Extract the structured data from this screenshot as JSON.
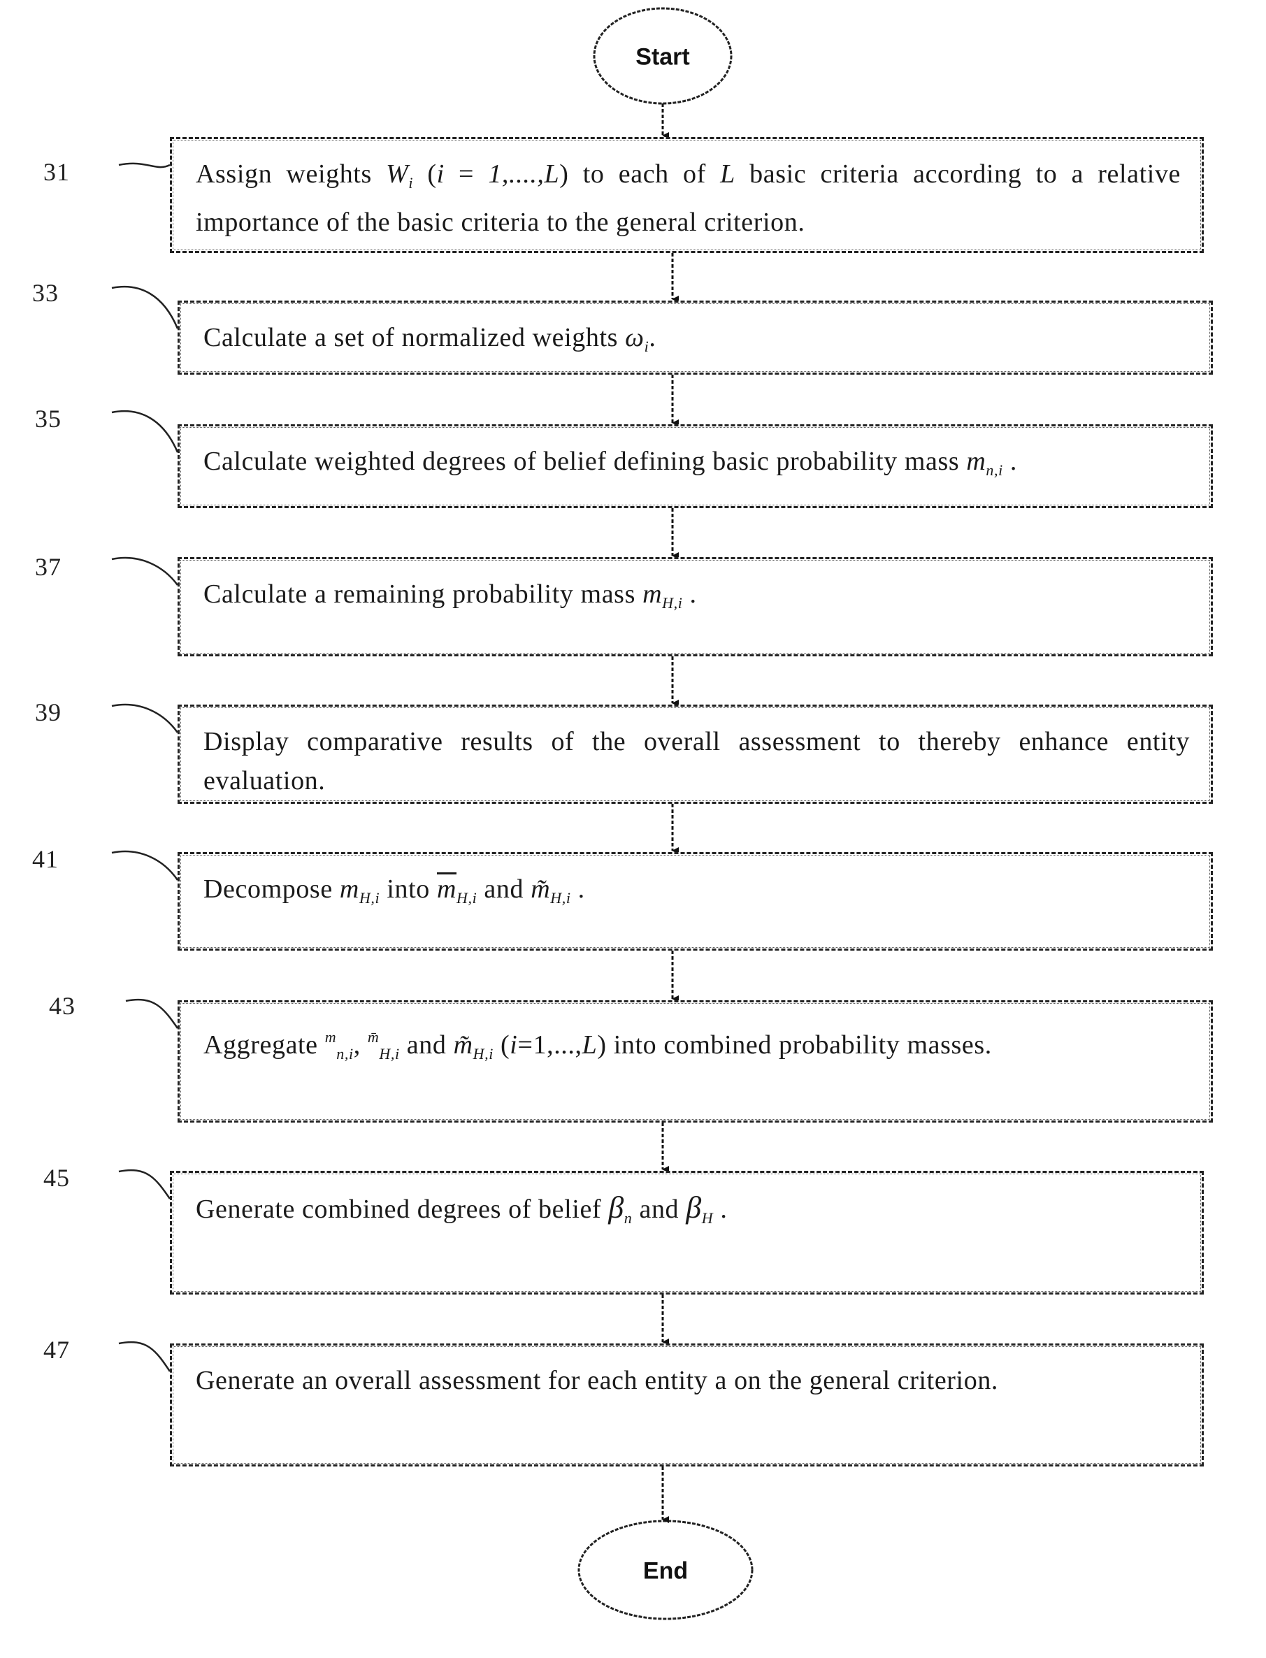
{
  "flowchart": {
    "start": {
      "label": "Start"
    },
    "end": {
      "label": "End"
    },
    "steps": [
      {
        "number": "31",
        "parts": [
          {
            "t": "Assign weights "
          },
          {
            "t": "W",
            "math": true
          },
          {
            "t": "i",
            "sub": true
          },
          {
            "t": " ("
          },
          {
            "t": "i",
            "math": true
          },
          {
            "t": " = "
          },
          {
            "t": "1,....,L",
            "math": true
          },
          {
            "t": ") to each of "
          },
          {
            "t": "L",
            "math": true
          },
          {
            "t": " basic criteria according to a relative importance of the basic criteria to the general criterion."
          }
        ],
        "text": "Assign weights W_i (i = 1,....,L) to each of L basic criteria according to a relative importance of the basic criteria to the general criterion."
      },
      {
        "number": "33",
        "parts": [
          {
            "t": "Calculate a set of normalized weights "
          },
          {
            "t": "ω",
            "math": true
          },
          {
            "t": "i",
            "sub": true
          },
          {
            "t": "."
          }
        ],
        "text": "Calculate a set of normalized weights ω_i."
      },
      {
        "number": "35",
        "parts": [
          {
            "t": "Calculate weighted degrees of belief defining basic probability mass "
          },
          {
            "t": "m",
            "math": true
          },
          {
            "t": "n,i",
            "sub": true
          },
          {
            "t": " ."
          }
        ],
        "text": "Calculate weighted degrees of belief defining basic probability mass m_n,i ."
      },
      {
        "number": "37",
        "parts": [
          {
            "t": "Calculate a remaining probability mass "
          },
          {
            "t": "m",
            "math": true
          },
          {
            "t": "H,i",
            "sub": true
          },
          {
            "t": " ."
          }
        ],
        "text": "Calculate a remaining probability mass m_H,i ."
      },
      {
        "number": "39",
        "parts": [
          {
            "t": "Display comparative results of the overall assessment to thereby enhance entity evaluation."
          }
        ],
        "text": "Display comparative results of the overall assessment to thereby enhance entity evaluation."
      },
      {
        "number": "41",
        "parts": [
          {
            "t": "Decompose "
          },
          {
            "t": "m",
            "math": true
          },
          {
            "t": "H,i",
            "sub": true
          },
          {
            "t": "  into "
          },
          {
            "t": "m",
            "math": true,
            "overline": true
          },
          {
            "t": "H,i",
            "sub": true
          },
          {
            "t": " and  "
          },
          {
            "t": "m̃",
            "math": true
          },
          {
            "t": "H,i",
            "sub": true
          },
          {
            "t": " ."
          }
        ],
        "text": "Decompose m_H,i into m̄_H,i and m̃_H,i ."
      },
      {
        "number": "43",
        "parts": [
          {
            "t": "Aggregate "
          },
          {
            "t": "m",
            "sup": true
          },
          {
            "t": "n,i",
            "sub": true
          },
          {
            "t": ", "
          },
          {
            "t": "m̄",
            "sup": true
          },
          {
            "t": "H,i",
            "sub": true
          },
          {
            "t": "  and  "
          },
          {
            "t": "m̃",
            "math": true
          },
          {
            "t": "H,i",
            "sub": true
          },
          {
            "t": " ("
          },
          {
            "t": "i",
            "math": true
          },
          {
            "t": "=1,...,"
          },
          {
            "t": "L",
            "math": true
          },
          {
            "t": ") into combined probability masses."
          }
        ],
        "text": "Aggregate m_n,i, m̄_H,i and m̃_H,i (i=1,...,L) into combined probability masses."
      },
      {
        "number": "45",
        "parts": [
          {
            "t": "Generate combined degrees of belief "
          },
          {
            "t": "β",
            "greek": true
          },
          {
            "t": "n",
            "sub": true
          },
          {
            "t": "  and  "
          },
          {
            "t": "β",
            "greek": true
          },
          {
            "t": "H",
            "sub": true
          },
          {
            "t": " ."
          }
        ],
        "text": "Generate combined degrees of belief β_n and β_H ."
      },
      {
        "number": "47",
        "parts": [
          {
            "t": "Generate an overall assessment for each entity a on the general criterion."
          }
        ],
        "text": "Generate an overall assessment for each entity a on the general criterion."
      }
    ]
  }
}
